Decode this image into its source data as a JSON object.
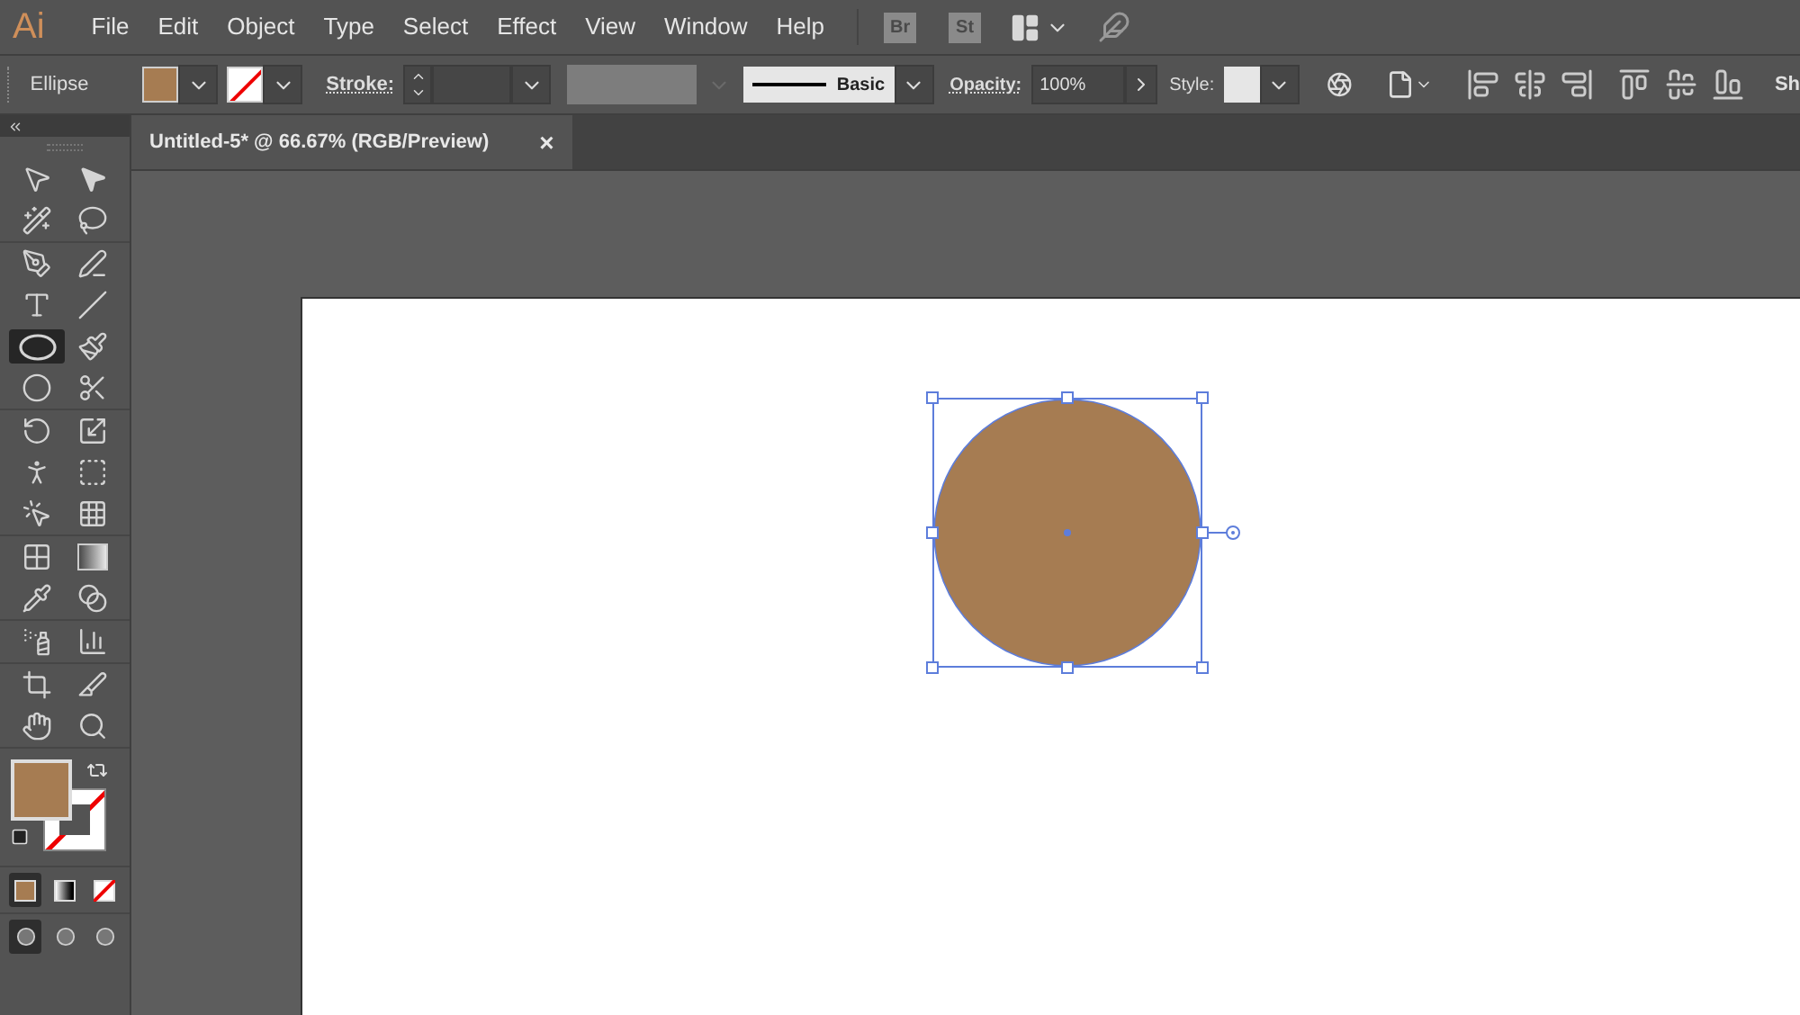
{
  "menu_bar": {
    "logo": "Ai",
    "menus": [
      "File",
      "Edit",
      "Object",
      "Type",
      "Select",
      "Effect",
      "View",
      "Window",
      "Help"
    ],
    "bridge": "Br",
    "stock": "St"
  },
  "control_bar": {
    "object_type": "Ellipse",
    "fill": {
      "color": "#a67c52"
    },
    "stroke": {
      "none": true
    },
    "stroke_label": "Stroke:",
    "brush": "Basic",
    "opacity_label": "Opacity:",
    "opacity": "100%",
    "style_label": "Style:",
    "cut_label": "Sh"
  },
  "document_tab": {
    "title": "Untitled-5* @ 66.67% (RGB/Preview)",
    "close": "×"
  },
  "tool_groups": [
    [
      {
        "selected": false
      },
      {
        "selected": false
      },
      {
        "selected": false
      },
      {
        "selected": false
      }
    ],
    [
      {
        "selected": false
      },
      {
        "selected": false
      },
      {
        "selected": false
      },
      {
        "selected": false
      },
      {
        "selected": true
      },
      {
        "selected": false
      },
      {
        "selected": false
      },
      {
        "selected": false
      }
    ],
    [
      {
        "selected": false
      },
      {
        "selected": false
      },
      {
        "selected": false
      },
      {
        "selected": false
      },
      {
        "selected": false
      },
      {
        "selected": false
      }
    ],
    [
      {
        "selected": false
      },
      {
        "selected": false
      },
      {
        "selected": false
      },
      {
        "selected": false
      }
    ],
    [
      {
        "selected": false
      },
      {
        "selected": false
      }
    ],
    [
      {
        "selected": false
      },
      {
        "selected": false
      },
      {
        "selected": false
      },
      {
        "selected": false
      }
    ]
  ],
  "color_modes": [
    {
      "selected": true
    },
    {
      "selected": false
    },
    {
      "selected": false
    }
  ],
  "draw_modes": [
    {
      "selected": true
    },
    {
      "selected": false
    },
    {
      "selected": false
    }
  ]
}
